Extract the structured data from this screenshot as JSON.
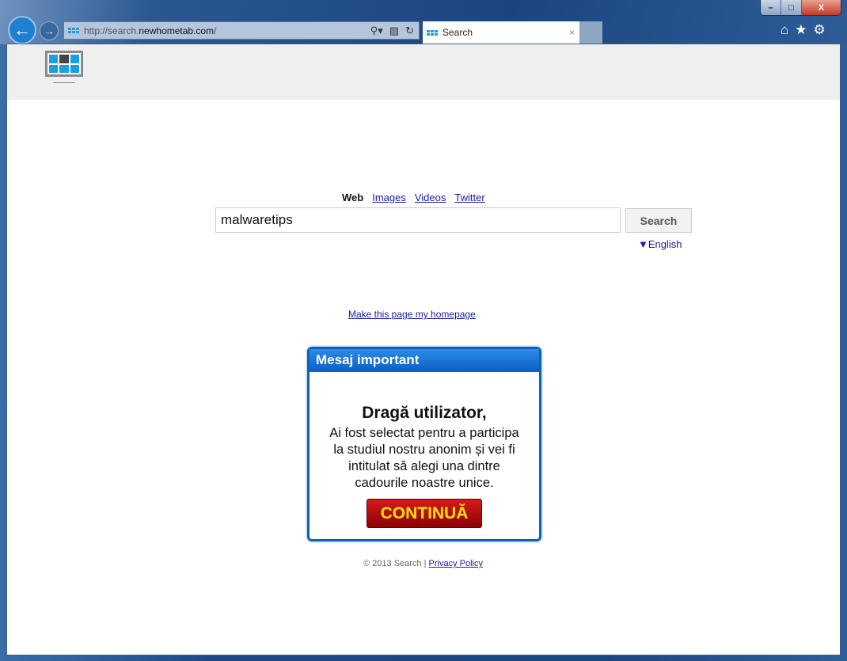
{
  "browser": {
    "url_prefix": "http://search.",
    "url_domain": "newhometab.com",
    "url_suffix": "/",
    "tab_title": "Search",
    "tab_close": "×",
    "window_controls": {
      "minimize": "–",
      "maximize": "□",
      "close": "X"
    }
  },
  "page": {
    "nav": [
      "Web",
      "Images",
      "Videos",
      "Twitter"
    ],
    "search_value": "malwaretips",
    "search_button": "Search",
    "language": "▼English",
    "homepage_link": "Make this page my homepage",
    "footer_copyright": "© 2013 Search |",
    "footer_privacy": "Privacy Policy"
  },
  "popup": {
    "header": "Mesaj important",
    "title": "Dragă utilizator,",
    "lines": [
      "Ai fost selectat pentru a participa",
      "la studiul nostru anonim și vei fi",
      "intitulat să alegi una dintre",
      "cadourile noastre unice."
    ],
    "button": "CONTINUĂ"
  }
}
